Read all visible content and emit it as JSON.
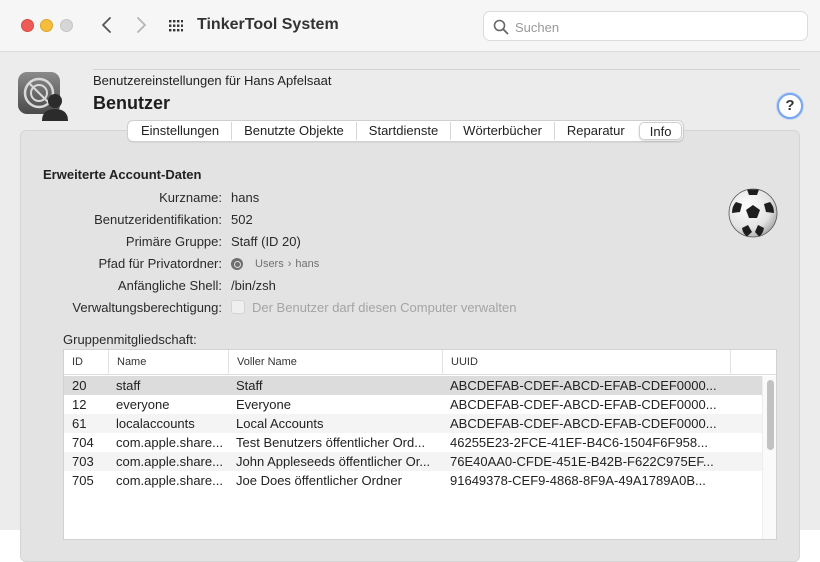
{
  "toolbar": {
    "app_title": "TinkerTool System",
    "search_placeholder": "Suchen"
  },
  "header": {
    "subtitle": "Benutzereinstellungen für Hans Apfelsaat",
    "title": "Benutzer",
    "help_label": "?"
  },
  "tabs": [
    {
      "label": "Einstellungen"
    },
    {
      "label": "Benutzte Objekte"
    },
    {
      "label": "Startdienste"
    },
    {
      "label": "Wörterbücher"
    },
    {
      "label": "Reparatur"
    },
    {
      "label": "Info"
    }
  ],
  "selected_tab": "Info",
  "info": {
    "section_title": "Erweiterte Account-Daten",
    "rows": [
      {
        "label": "Kurzname:",
        "value": "hans"
      },
      {
        "label": "Benutzeridentifikation:",
        "value": "502"
      },
      {
        "label": "Primäre Gruppe:",
        "value": "Staff (ID 20)"
      },
      {
        "label": "Pfad für Privatordner:",
        "value": ""
      },
      {
        "label": "Anfängliche Shell:",
        "value": "/bin/zsh"
      },
      {
        "label": "Verwaltungsberechtigung:",
        "value": ""
      }
    ],
    "home_path": [
      "Users",
      "hans"
    ],
    "path_separator": "›",
    "admin_checkbox_label": "Der Benutzer darf diesen Computer verwalten",
    "admin_checked": false
  },
  "groups": {
    "label": "Gruppenmitgliedschaft:",
    "columns": [
      "ID",
      "Name",
      "Voller Name",
      "UUID"
    ],
    "rows": [
      {
        "id": "20",
        "name": "staff",
        "full_name": "Staff",
        "uuid": "ABCDEFAB-CDEF-ABCD-EFAB-CDEF0000..."
      },
      {
        "id": "12",
        "name": "everyone",
        "full_name": "Everyone",
        "uuid": "ABCDEFAB-CDEF-ABCD-EFAB-CDEF0000..."
      },
      {
        "id": "61",
        "name": "localaccounts",
        "full_name": "Local Accounts",
        "uuid": "ABCDEFAB-CDEF-ABCD-EFAB-CDEF0000..."
      },
      {
        "id": "704",
        "name": "com.apple.share...",
        "full_name": "Test Benutzers öffentlicher Ord...",
        "uuid": "46255E23-2FCE-41EF-B4C6-1504F6F958..."
      },
      {
        "id": "703",
        "name": "com.apple.share...",
        "full_name": "John Appleseeds öffentlicher Or...",
        "uuid": "76E40AA0-CFDE-451E-B42B-F622C975EF..."
      },
      {
        "id": "705",
        "name": "com.apple.share...",
        "full_name": "Joe Does öffentlicher Ordner",
        "uuid": "91649378-CEF9-4868-8F9A-49A1789A0B..."
      }
    ]
  },
  "colors": {
    "close": "#ee5d55",
    "minimize": "#f5bd3b",
    "zoom": "#d6d6d6",
    "help_ring": "#7aa7ec"
  },
  "icons": [
    "back-chevron-icon",
    "forward-chevron-icon",
    "app-grid-icon",
    "search-icon",
    "user-accounts-icon",
    "soccer-ball-icon",
    "disk-icon"
  ]
}
